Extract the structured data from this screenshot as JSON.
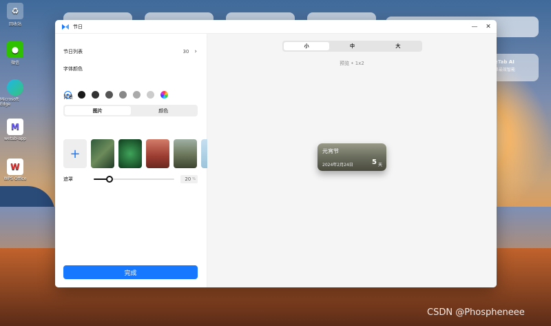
{
  "desktop": {
    "icons": [
      {
        "label": "回收站",
        "icon": "recycle-bin-icon"
      },
      {
        "label": "微信",
        "icon": "wechat-icon"
      },
      {
        "label": "Microsoft Edge",
        "icon": "edge-icon"
      },
      {
        "label": "wetab-app",
        "icon": "wetab-icon"
      },
      {
        "label": "WPS Office",
        "icon": "wps-icon"
      }
    ],
    "ai_card": {
      "title": "eTab AI",
      "subtitle": "事最效智能"
    },
    "watermark": "CSDN @Phospheneee"
  },
  "window": {
    "title": "节日",
    "minimize_glyph": "—",
    "close_glyph": "✕"
  },
  "settings": {
    "festival_list_label": "节日列表",
    "festival_count": "30",
    "chevron_glyph": "›",
    "font_color_label": "字体颜色",
    "font_colors": [
      "#ffffff",
      "#1a1a1a",
      "#333333",
      "#555555",
      "#888888",
      "#aaaaaa",
      "#cccccc"
    ],
    "background_label": "背景",
    "bg_tabs": [
      "图片",
      "颜色"
    ],
    "bg_tab_selected": "图片",
    "add_glyph": "+",
    "mask_label": "遮罩",
    "mask_value": 20,
    "mask_value_text": "20",
    "mask_unit": "%",
    "done_label": "完成"
  },
  "preview": {
    "size_tabs": [
      "小",
      "中",
      "大"
    ],
    "size_selected": "小",
    "preview_label": "预览 • 1x2",
    "card": {
      "name": "元宵节",
      "date": "2024年2月24日",
      "days": "5",
      "unit": "天"
    }
  },
  "colors": {
    "accent": "#1677ff"
  }
}
